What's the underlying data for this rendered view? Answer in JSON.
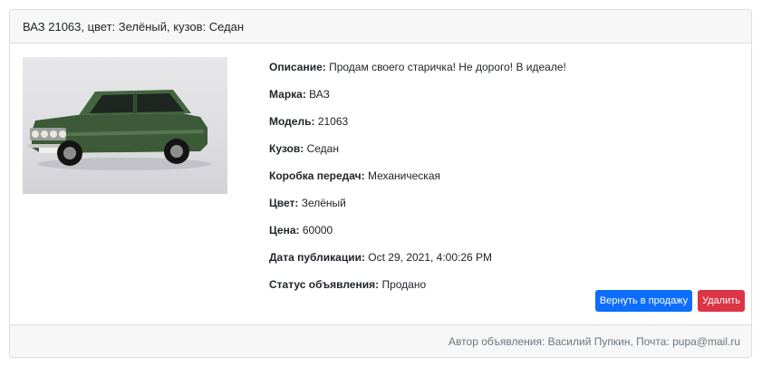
{
  "card": {
    "header_title": "ВАЗ 21063, цвет: Зелёный, кузов: Седан",
    "image": {
      "icon": "car-photo"
    },
    "details": [
      {
        "label": "Описание:",
        "value": "Продам своего старичка! Не дорого! В идеале!"
      },
      {
        "label": "Марка:",
        "value": "ВАЗ"
      },
      {
        "label": "Модель:",
        "value": "21063"
      },
      {
        "label": "Кузов:",
        "value": "Седан"
      },
      {
        "label": "Коробка передач:",
        "value": "Механическая"
      },
      {
        "label": "Цвет:",
        "value": "Зелёный"
      },
      {
        "label": "Цена:",
        "value": "60000"
      },
      {
        "label": "Дата публикации:",
        "value": "Oct 29, 2021, 4:00:26 PM"
      },
      {
        "label": "Статус объявления:",
        "value": "Продано"
      }
    ],
    "buttons": {
      "return_label": "Вернуть в продажу",
      "delete_label": "Удалить",
      "primary_color": "#0d6efd",
      "danger_color": "#dc3545"
    },
    "footer_text": "Автор объявления: Василий Пупкин, Почта: pupa@mail.ru"
  }
}
